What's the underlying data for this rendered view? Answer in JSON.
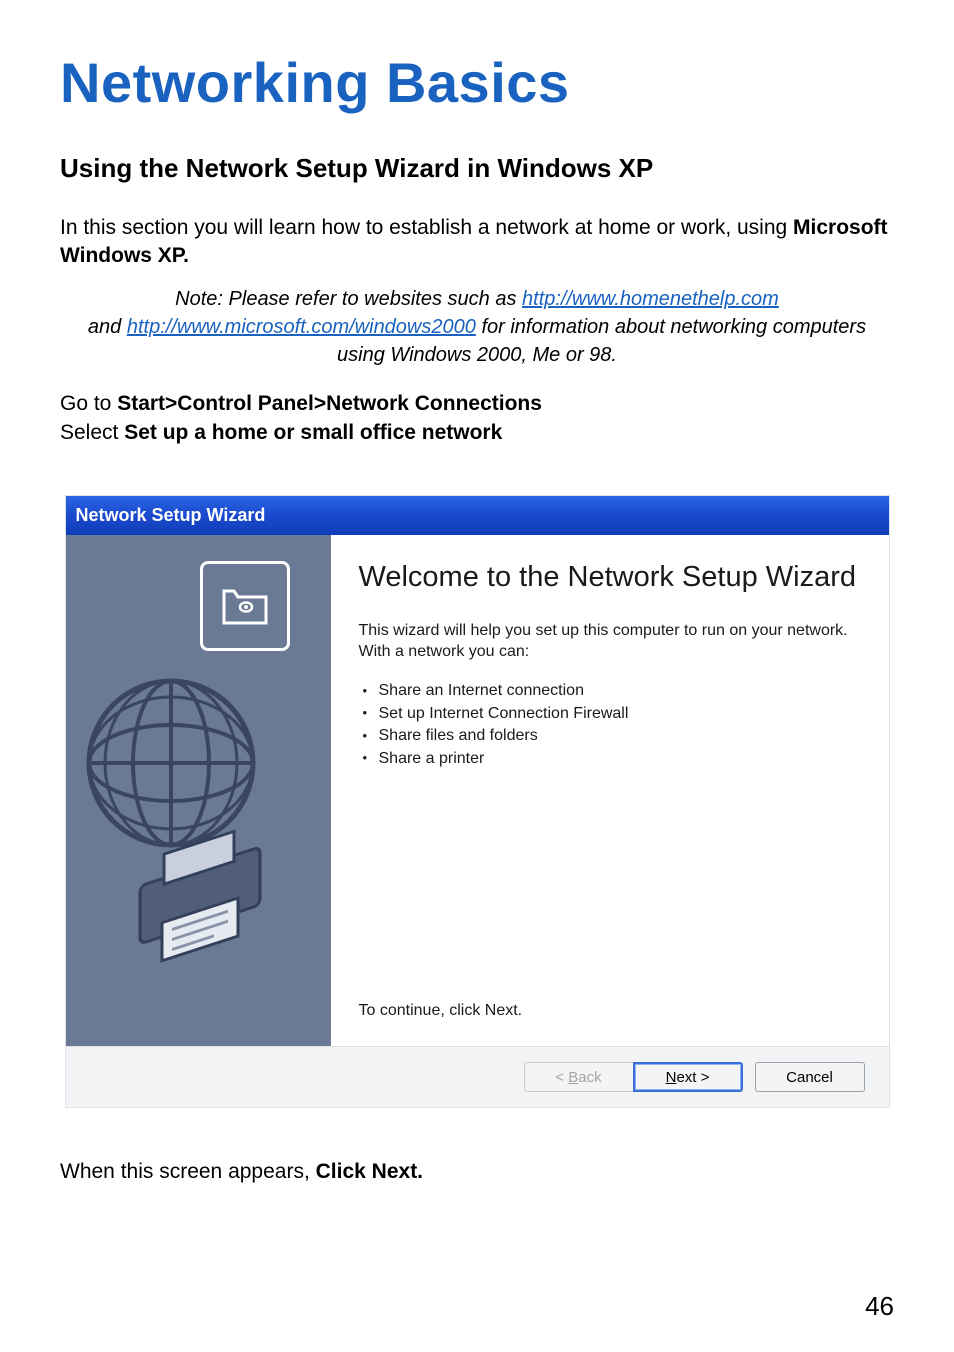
{
  "title": "Networking Basics",
  "section_heading": "Using the Network Setup Wizard in Windows XP",
  "intro_pre": "In this section you will learn how to establish a network at home or work, using ",
  "intro_bold": "Microsoft Windows XP.",
  "note": {
    "prefix": "Note:  Please refer to websites such as ",
    "link1": "http://www.homenethelp.com",
    "mid1": "and ",
    "link2": "http://www.microsoft.com/windows2000",
    "mid2": "  for information about networking computers using Windows 2000, Me or 98."
  },
  "steps": {
    "line1_pre": "Go to ",
    "line1_bold": "Start>Control Panel>Network Connections",
    "line2_pre": "Select ",
    "line2_bold": "Set up a home or small office network"
  },
  "wizard": {
    "titlebar": "Network Setup Wizard",
    "heading": "Welcome to the Network Setup Wizard",
    "body_text": "This wizard will help you set up this computer to run on your network. With a network you can:",
    "list": [
      "Share an Internet connection",
      "Set up Internet Connection Firewall",
      "Share files and folders",
      "Share a printer"
    ],
    "continue": "To continue, click Next.",
    "buttons": {
      "back_prefix": "< ",
      "back_u": "B",
      "back_suffix": "ack",
      "next_u": "N",
      "next_suffix": "ext >",
      "cancel": "Cancel"
    }
  },
  "after_pre": "When this screen appears, ",
  "after_bold": "Click Next.",
  "page_number": "46"
}
